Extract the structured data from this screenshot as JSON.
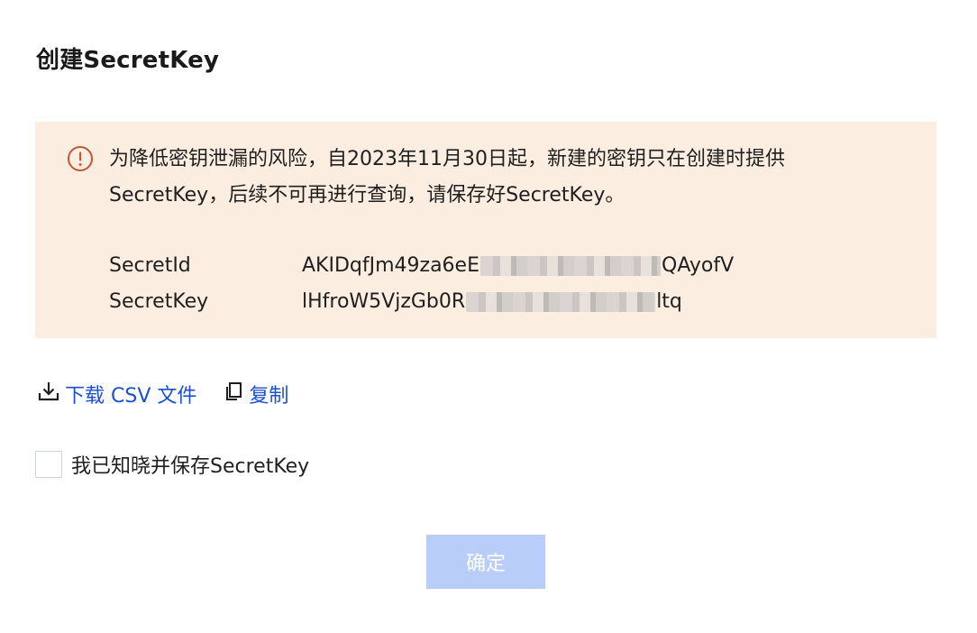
{
  "dialog": {
    "title": "创建SecretKey"
  },
  "notice": {
    "icon": "warning-circle-icon",
    "color": "#fcede1",
    "icon_color": "#c0583a",
    "message": "为降低密钥泄漏的风险，自2023年11月30日起，新建的密钥只在创建时提供SecretKey，后续不可再进行查询，请保存好SecretKey。",
    "secret_id": {
      "label": "SecretId",
      "value_prefix": "AKIDqfJm49za6eE",
      "value_suffix": "QAyofV"
    },
    "secret_key": {
      "label": "SecretKey",
      "value_prefix": "lHfroW5VjzGb0R",
      "value_suffix": "ltq"
    }
  },
  "actions": {
    "download": {
      "label": "下载 CSV 文件",
      "icon": "download-icon"
    },
    "copy": {
      "label": "复制",
      "icon": "copy-icon"
    },
    "link_color": "#1a4fd6"
  },
  "acknowledge": {
    "label": "我已知晓并保存SecretKey",
    "checked": false
  },
  "confirm": {
    "label": "确定",
    "disabled": true,
    "color": "#b8cdf8"
  }
}
